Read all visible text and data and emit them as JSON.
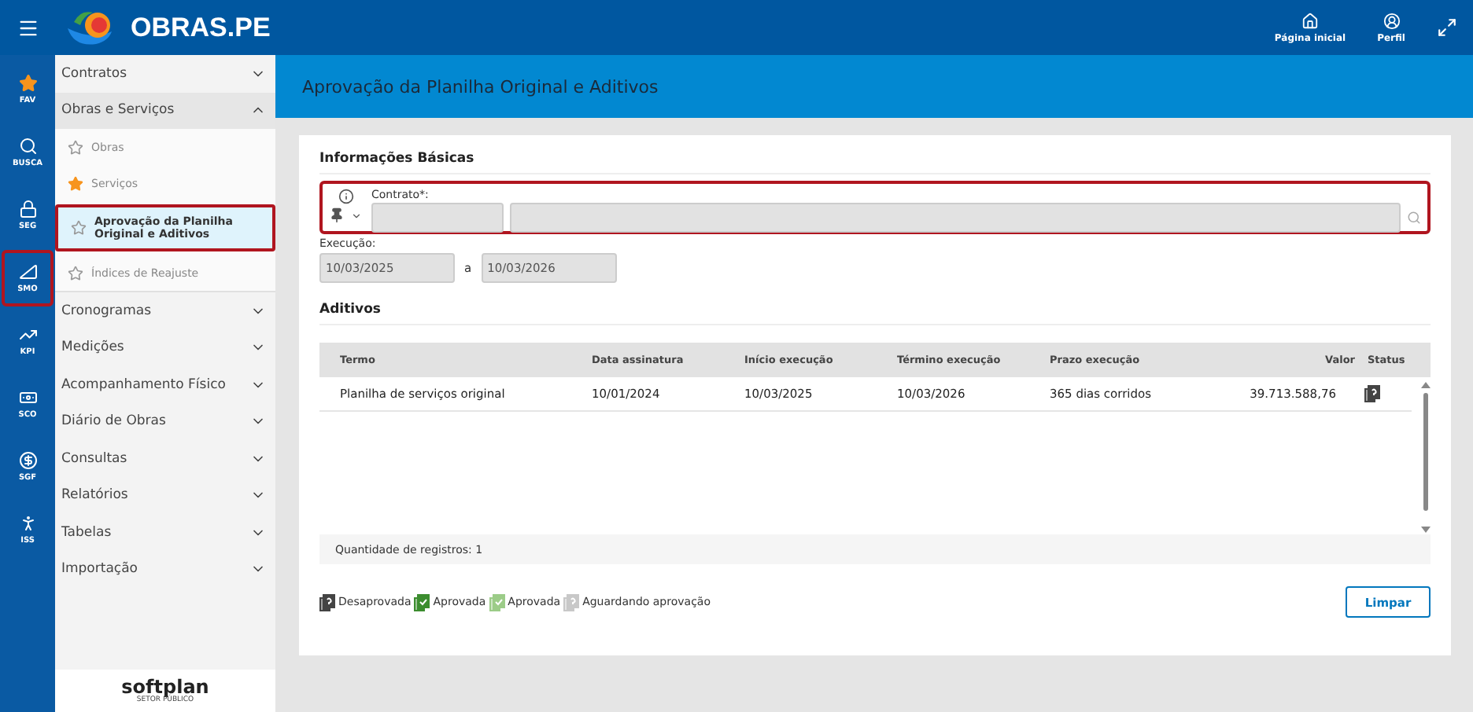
{
  "topbar": {
    "brand": "OBRAS.PE",
    "actions": [
      {
        "kind": "home",
        "label": "Página inicial"
      },
      {
        "kind": "profile",
        "label": "Perfil"
      },
      {
        "kind": "expand"
      }
    ]
  },
  "rail": [
    {
      "kind": "fav",
      "label": "FAV",
      "highlighted": false
    },
    {
      "kind": "search",
      "label": "BUSCA",
      "highlighted": false
    },
    {
      "kind": "lock",
      "label": "SEG",
      "highlighted": false
    },
    {
      "kind": "ruler",
      "label": "SMO",
      "highlighted": true
    },
    {
      "kind": "chart",
      "label": "KPI",
      "highlighted": false
    },
    {
      "kind": "cash",
      "label": "SCO",
      "highlighted": false
    },
    {
      "kind": "dollar",
      "label": "SGF",
      "highlighted": false
    },
    {
      "kind": "person",
      "label": "ISS",
      "highlighted": false
    }
  ],
  "sidebar": {
    "items": [
      {
        "label": "Contratos",
        "expanded": false
      },
      {
        "label": "Obras e Serviços",
        "expanded": true,
        "children": [
          {
            "label": "Obras",
            "favorite": false,
            "selected": false,
            "highlighted": false
          },
          {
            "label": "Serviços",
            "favorite": true,
            "selected": false,
            "highlighted": false
          },
          {
            "label": "Aprovação da Planilha Original e Aditivos",
            "favorite": false,
            "selected": true,
            "highlighted": true
          },
          {
            "label": "Índices de Reajuste",
            "favorite": false,
            "selected": false,
            "highlighted": false
          }
        ]
      },
      {
        "label": "Cronogramas",
        "expanded": false
      },
      {
        "label": "Medições",
        "expanded": false
      },
      {
        "label": "Acompanhamento Físico",
        "expanded": false
      },
      {
        "label": "Diário de Obras",
        "expanded": false
      },
      {
        "label": "Consultas",
        "expanded": false
      },
      {
        "label": "Relatórios",
        "expanded": false
      },
      {
        "label": "Tabelas",
        "expanded": false
      },
      {
        "label": "Importação",
        "expanded": false
      }
    ],
    "footer": {
      "brand": "softplan",
      "tagline": "SETOR PÚBLICO"
    }
  },
  "page_title": "Aprovação da Planilha Original e Aditivos",
  "basic_info": {
    "title": "Informações Básicas",
    "contract": {
      "label": "Contrato*:",
      "highlighted": true
    },
    "execution": {
      "label": "Execução:",
      "start": "10/03/2025",
      "separator": "a",
      "end": "10/03/2026"
    }
  },
  "aditivos": {
    "title": "Aditivos",
    "columns": [
      "Termo",
      "Data assinatura",
      "Início execução",
      "Término execução",
      "Prazo execução",
      "Valor",
      "Status"
    ],
    "rows": [
      {
        "cells": [
          "Planilha de serviços original",
          "10/01/2024",
          "10/03/2025",
          "10/03/2026",
          "365 dias corridos",
          "39.713.588,76"
        ],
        "status": {
          "kind": "question",
          "color": "#444444"
        }
      }
    ],
    "count": "Quantidade de registros: 1"
  },
  "legend": [
    {
      "kind": "question",
      "color": "#444444",
      "label": "Desaprovada"
    },
    {
      "kind": "check",
      "color": "#3c8d2f",
      "label": "Aprovada"
    },
    {
      "kind": "check",
      "color": "#9ccc88",
      "label": "Aprovada"
    },
    {
      "kind": "question",
      "color": "#c8c8c8",
      "label": "Aguardando aprovação"
    }
  ],
  "buttons": [
    {
      "label": "Limpar"
    }
  ]
}
